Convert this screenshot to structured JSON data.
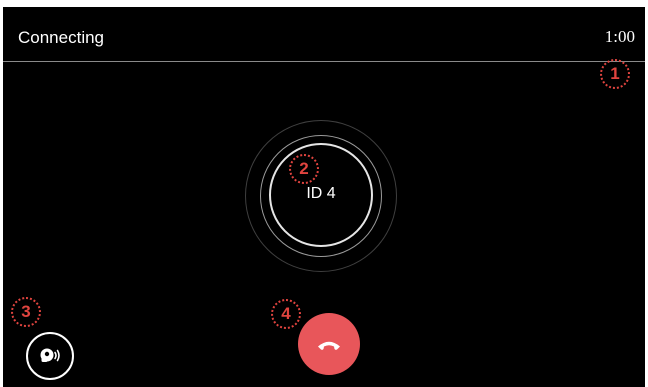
{
  "call": {
    "status": "Connecting",
    "timer": "1:00",
    "device_id": "ID 4"
  },
  "markers": [
    "1",
    "2",
    "3",
    "4"
  ],
  "controls": {
    "speaker_icon": "speaker-voice-icon",
    "hangup_icon": "phone-hangup-icon"
  },
  "colors": {
    "background": "#000000",
    "hangup": "#e8565a",
    "annotation": "#e0443f",
    "text": "#ffffff"
  }
}
